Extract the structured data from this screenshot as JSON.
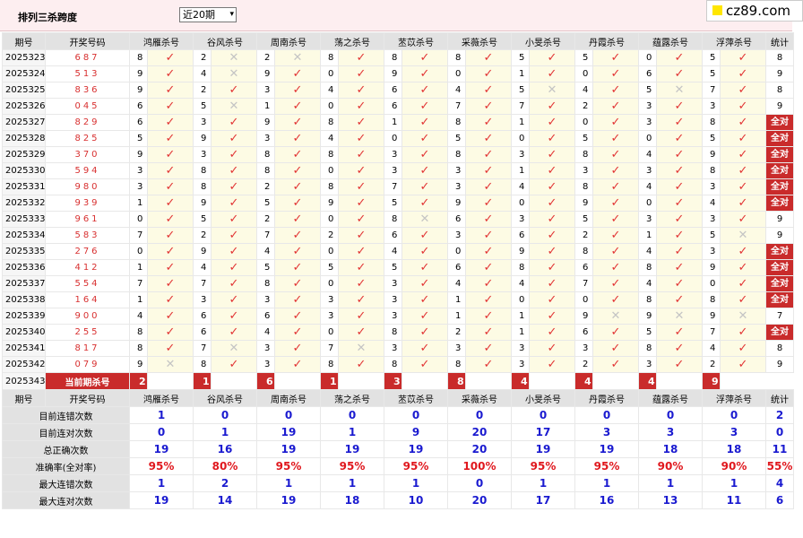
{
  "header": {
    "title": "排列三杀跨度",
    "period_select": "近20期",
    "logo": "cz89.com",
    "logo_accent": "#ffe600"
  },
  "columns": {
    "issue": "期号",
    "numbers": "开奖号码",
    "stat": "统计",
    "experts": [
      "鸿雁杀号",
      "谷风杀号",
      "周南杀号",
      "荡之杀号",
      "苤苡杀号",
      "采薇杀号",
      "小旻杀号",
      "丹霞杀号",
      "蕴露杀号",
      "浮萍杀号"
    ]
  },
  "marks": {
    "hit": "✓",
    "miss": "✕",
    "all_right_label": "全对"
  },
  "rows": [
    {
      "issue": "2025323",
      "numbers": "687",
      "kills": [
        "8",
        "2",
        "2",
        "8",
        "8",
        "8",
        "5",
        "5",
        "0",
        "5"
      ],
      "hits": [
        1,
        0,
        0,
        1,
        1,
        1,
        1,
        1,
        1,
        1
      ],
      "stat": "8"
    },
    {
      "issue": "2025324",
      "numbers": "513",
      "kills": [
        "9",
        "4",
        "9",
        "0",
        "9",
        "0",
        "1",
        "0",
        "6",
        "5"
      ],
      "hits": [
        1,
        0,
        1,
        1,
        1,
        1,
        1,
        1,
        1,
        1
      ],
      "stat": "9"
    },
    {
      "issue": "2025325",
      "numbers": "836",
      "kills": [
        "9",
        "2",
        "3",
        "4",
        "6",
        "4",
        "5",
        "4",
        "5",
        "7"
      ],
      "hits": [
        1,
        1,
        1,
        1,
        1,
        1,
        0,
        1,
        0,
        1
      ],
      "stat": "8"
    },
    {
      "issue": "2025326",
      "numbers": "045",
      "kills": [
        "6",
        "5",
        "1",
        "0",
        "6",
        "7",
        "7",
        "2",
        "3",
        "3"
      ],
      "hits": [
        1,
        0,
        1,
        1,
        1,
        1,
        1,
        1,
        1,
        1
      ],
      "stat": "9"
    },
    {
      "issue": "2025327",
      "numbers": "829",
      "kills": [
        "6",
        "3",
        "9",
        "8",
        "1",
        "8",
        "1",
        "0",
        "3",
        "8"
      ],
      "hits": [
        1,
        1,
        1,
        1,
        1,
        1,
        1,
        1,
        1,
        1
      ],
      "stat": "全对"
    },
    {
      "issue": "2025328",
      "numbers": "825",
      "kills": [
        "5",
        "9",
        "3",
        "4",
        "0",
        "5",
        "0",
        "5",
        "0",
        "5"
      ],
      "hits": [
        1,
        1,
        1,
        1,
        1,
        1,
        1,
        1,
        1,
        1
      ],
      "stat": "全对"
    },
    {
      "issue": "2025329",
      "numbers": "370",
      "kills": [
        "9",
        "3",
        "8",
        "8",
        "3",
        "8",
        "3",
        "8",
        "4",
        "9"
      ],
      "hits": [
        1,
        1,
        1,
        1,
        1,
        1,
        1,
        1,
        1,
        1
      ],
      "stat": "全对"
    },
    {
      "issue": "2025330",
      "numbers": "594",
      "kills": [
        "3",
        "8",
        "8",
        "0",
        "3",
        "3",
        "1",
        "3",
        "3",
        "8"
      ],
      "hits": [
        1,
        1,
        1,
        1,
        1,
        1,
        1,
        1,
        1,
        1
      ],
      "stat": "全对"
    },
    {
      "issue": "2025331",
      "numbers": "980",
      "kills": [
        "3",
        "8",
        "2",
        "8",
        "7",
        "3",
        "4",
        "8",
        "4",
        "3"
      ],
      "hits": [
        1,
        1,
        1,
        1,
        1,
        1,
        1,
        1,
        1,
        1
      ],
      "stat": "全对"
    },
    {
      "issue": "2025332",
      "numbers": "939",
      "kills": [
        "1",
        "9",
        "5",
        "9",
        "5",
        "9",
        "0",
        "9",
        "0",
        "4"
      ],
      "hits": [
        1,
        1,
        1,
        1,
        1,
        1,
        1,
        1,
        1,
        1
      ],
      "stat": "全对"
    },
    {
      "issue": "2025333",
      "numbers": "961",
      "kills": [
        "0",
        "5",
        "2",
        "0",
        "8",
        "6",
        "3",
        "5",
        "3",
        "3"
      ],
      "hits": [
        1,
        1,
        1,
        1,
        0,
        1,
        1,
        1,
        1,
        1
      ],
      "stat": "9"
    },
    {
      "issue": "2025334",
      "numbers": "583",
      "kills": [
        "7",
        "2",
        "7",
        "2",
        "6",
        "3",
        "6",
        "2",
        "1",
        "5"
      ],
      "hits": [
        1,
        1,
        1,
        1,
        1,
        1,
        1,
        1,
        1,
        0
      ],
      "stat": "9"
    },
    {
      "issue": "2025335",
      "numbers": "276",
      "kills": [
        "0",
        "9",
        "4",
        "0",
        "4",
        "0",
        "9",
        "8",
        "4",
        "3"
      ],
      "hits": [
        1,
        1,
        1,
        1,
        1,
        1,
        1,
        1,
        1,
        1
      ],
      "stat": "全对"
    },
    {
      "issue": "2025336",
      "numbers": "412",
      "kills": [
        "1",
        "4",
        "5",
        "5",
        "5",
        "6",
        "8",
        "6",
        "8",
        "9"
      ],
      "hits": [
        1,
        1,
        1,
        1,
        1,
        1,
        1,
        1,
        1,
        1
      ],
      "stat": "全对"
    },
    {
      "issue": "2025337",
      "numbers": "554",
      "kills": [
        "7",
        "7",
        "8",
        "0",
        "3",
        "4",
        "4",
        "7",
        "4",
        "0"
      ],
      "hits": [
        1,
        1,
        1,
        1,
        1,
        1,
        1,
        1,
        1,
        1
      ],
      "stat": "全对"
    },
    {
      "issue": "2025338",
      "numbers": "164",
      "kills": [
        "1",
        "3",
        "3",
        "3",
        "3",
        "1",
        "0",
        "0",
        "8",
        "8"
      ],
      "hits": [
        1,
        1,
        1,
        1,
        1,
        1,
        1,
        1,
        1,
        1
      ],
      "stat": "全对"
    },
    {
      "issue": "2025339",
      "numbers": "900",
      "kills": [
        "4",
        "6",
        "6",
        "3",
        "3",
        "1",
        "1",
        "9",
        "9",
        "9"
      ],
      "hits": [
        1,
        1,
        1,
        1,
        1,
        1,
        1,
        0,
        0,
        0
      ],
      "stat": "7"
    },
    {
      "issue": "2025340",
      "numbers": "255",
      "kills": [
        "8",
        "6",
        "4",
        "0",
        "8",
        "2",
        "1",
        "6",
        "5",
        "7"
      ],
      "hits": [
        1,
        1,
        1,
        1,
        1,
        1,
        1,
        1,
        1,
        1
      ],
      "stat": "全对"
    },
    {
      "issue": "2025341",
      "numbers": "817",
      "kills": [
        "8",
        "7",
        "3",
        "7",
        "3",
        "3",
        "3",
        "3",
        "8",
        "4"
      ],
      "hits": [
        1,
        0,
        1,
        0,
        1,
        1,
        1,
        1,
        1,
        1
      ],
      "stat": "8"
    },
    {
      "issue": "2025342",
      "numbers": "079",
      "kills": [
        "9",
        "8",
        "3",
        "8",
        "8",
        "8",
        "3",
        "2",
        "3",
        "2"
      ],
      "hits": [
        0,
        1,
        1,
        1,
        1,
        1,
        1,
        1,
        1,
        1
      ],
      "stat": "9"
    }
  ],
  "current": {
    "issue": "2025343",
    "label": "当前期杀号",
    "kills": [
      "2",
      "1",
      "6",
      "1",
      "3",
      "8",
      "4",
      "4",
      "4",
      "9"
    ]
  },
  "summary_labels": {
    "issue": "期号",
    "numbers": "开奖号码",
    "stat": "统计"
  },
  "summary": [
    {
      "label": "目前连错次数",
      "values": [
        "1",
        "0",
        "0",
        "0",
        "0",
        "0",
        "0",
        "0",
        "0",
        "0"
      ],
      "stat": "2"
    },
    {
      "label": "目前连对次数",
      "values": [
        "0",
        "1",
        "19",
        "1",
        "9",
        "20",
        "17",
        "3",
        "3",
        "3"
      ],
      "stat": "0"
    },
    {
      "label": "总正确次数",
      "values": [
        "19",
        "16",
        "19",
        "19",
        "19",
        "20",
        "19",
        "19",
        "18",
        "18"
      ],
      "stat": "11"
    },
    {
      "label": "准确率(全对率)",
      "values": [
        "95%",
        "80%",
        "95%",
        "95%",
        "95%",
        "100%",
        "95%",
        "95%",
        "90%",
        "90%"
      ],
      "stat": "55%",
      "red": true
    },
    {
      "label": "最大连错次数",
      "values": [
        "1",
        "2",
        "1",
        "1",
        "1",
        "0",
        "1",
        "1",
        "1",
        "1"
      ],
      "stat": "4"
    },
    {
      "label": "最大连对次数",
      "values": [
        "19",
        "14",
        "19",
        "18",
        "10",
        "20",
        "17",
        "16",
        "13",
        "11"
      ],
      "stat": "6"
    }
  ],
  "colors": {
    "accent_red": "#c92b2b",
    "hit": "#e23434",
    "miss": "#c4c4c4",
    "value_blue": "#1a1ad0",
    "header_bg": "#e2e2e2",
    "topbar_bg": "#fdeef0"
  }
}
